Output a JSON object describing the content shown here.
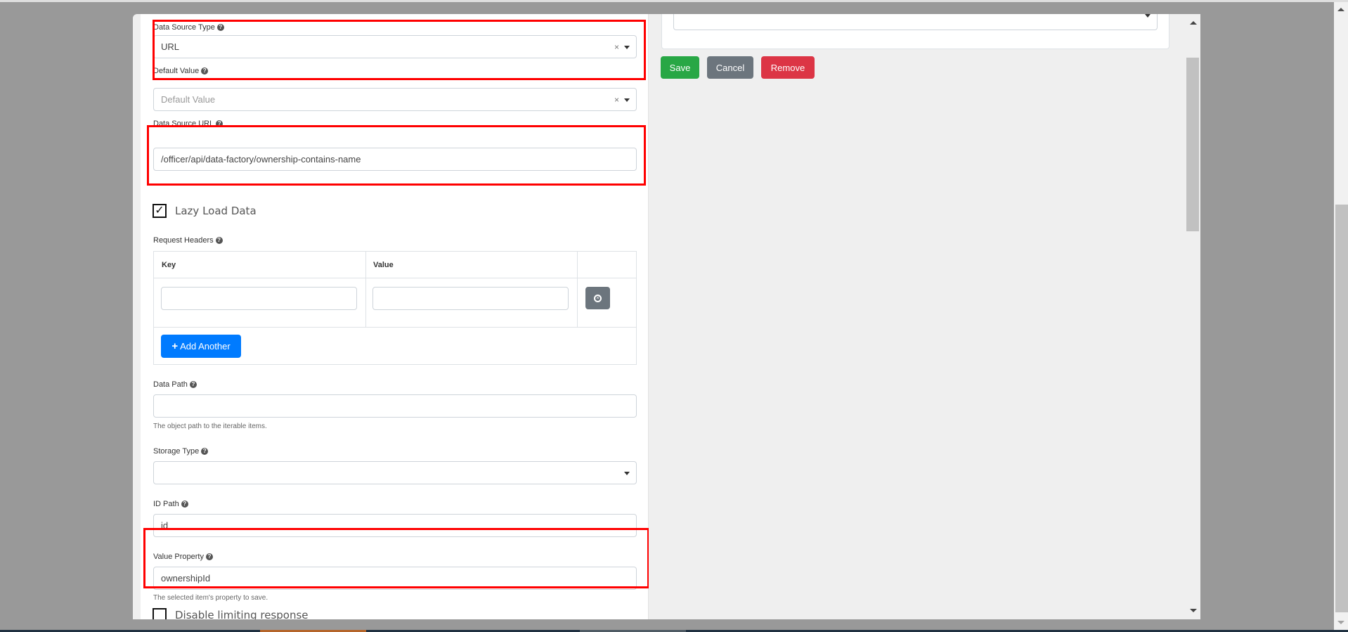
{
  "form": {
    "data_source_type": {
      "label": "Data Source Type",
      "value": "URL",
      "help_icon": "question-circle-icon"
    },
    "default_value": {
      "label": "Default Value",
      "placeholder": "Default Value",
      "value": ""
    },
    "data_source_url": {
      "label": "Data Source URL",
      "value": "/officer/api/data-factory/ownership-contains-name"
    },
    "lazy_load": {
      "label": "Lazy Load Data",
      "checked": true,
      "check_glyph": "✓"
    },
    "request_headers": {
      "label": "Request Headers",
      "columns": [
        "Key",
        "Value"
      ],
      "rows": [
        {
          "key": "",
          "value": ""
        }
      ],
      "remove_icon": "remove-circle-icon",
      "add_label": "Add Another",
      "add_icon": "+"
    },
    "data_path": {
      "label": "Data Path",
      "value": "",
      "help": "The object path to the iterable items."
    },
    "storage_type": {
      "label": "Storage Type",
      "value": ""
    },
    "id_path": {
      "label": "ID Path",
      "value": "id"
    },
    "value_property": {
      "label": "Value Property",
      "value": "ownershipId",
      "help": "The selected item's property to save."
    },
    "disable_limiting": {
      "label": "Disable limiting response",
      "checked": false
    }
  },
  "actions": {
    "save": "Save",
    "cancel": "Cancel",
    "remove": "Remove"
  },
  "icons": {
    "help": "?",
    "clear": "×",
    "remove_glyph": "×"
  },
  "colors": {
    "highlight": "#ff0000",
    "save": "#28a745",
    "cancel": "#6c757d",
    "remove": "#dc3545",
    "add": "#007bff"
  }
}
